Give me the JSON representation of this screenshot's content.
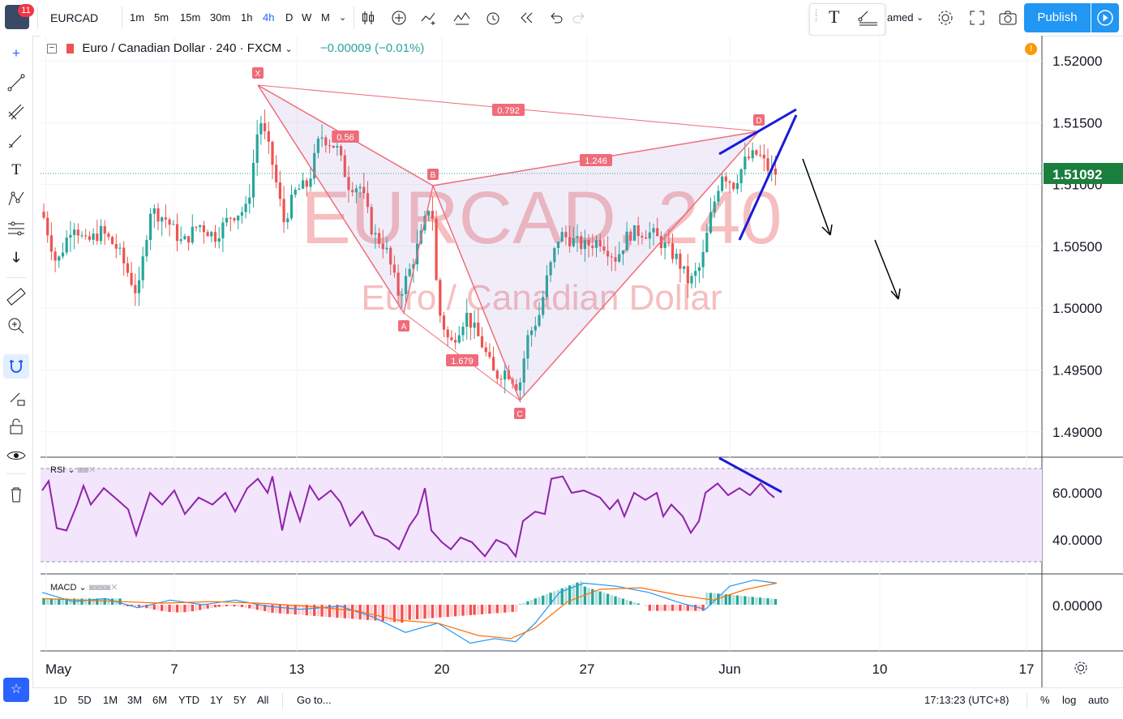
{
  "toolbar": {
    "notifications": "11",
    "symbol": "EURCAD",
    "intervals": [
      "1m",
      "5m",
      "15m",
      "30m",
      "1h",
      "4h",
      "D",
      "W",
      "M"
    ],
    "active_interval": "4h",
    "layout_name_partial": "amed",
    "publish_label": "Publish"
  },
  "legend": {
    "title": "Euro / Canadian Dollar · 240 · FXCM",
    "change": "−0.00009 (−0.01%)"
  },
  "watermark": {
    "symbol": "EURCAD, 240",
    "name": "Euro / Canadian Dollar"
  },
  "price_axis": {
    "labels": [
      "1.52000",
      "1.51500",
      "1.51000",
      "1.50500",
      "1.50000",
      "1.49500",
      "1.49000"
    ],
    "current": "1.51092"
  },
  "rsi": {
    "label": "RSI",
    "levels": [
      "60.0000",
      "40.0000"
    ]
  },
  "macd": {
    "label": "MACD",
    "level": "0.00000"
  },
  "time_axis": [
    "May",
    "7",
    "13",
    "20",
    "27",
    "Jun",
    "10",
    "17"
  ],
  "pattern": {
    "points": [
      "X",
      "A",
      "B",
      "C",
      "D"
    ],
    "ratios": {
      "xb": "0.56",
      "ac": "1.679",
      "bd": "1.246",
      "xd": "0.792"
    }
  },
  "bottombar": {
    "ranges": [
      "1D",
      "5D",
      "1M",
      "3M",
      "6M",
      "YTD",
      "1Y",
      "5Y",
      "All"
    ],
    "goto": "Go to...",
    "clock": "17:13:23 (UTC+8)",
    "percent": "%",
    "log": "log",
    "auto": "auto"
  },
  "colors": {
    "up": "#26a69a",
    "down": "#ef5350",
    "pattern": "#f06c7a",
    "rsi": "#8e24aa",
    "macd": "#2196f3",
    "signal": "#ff6d00",
    "accent": "#2962ff"
  }
}
